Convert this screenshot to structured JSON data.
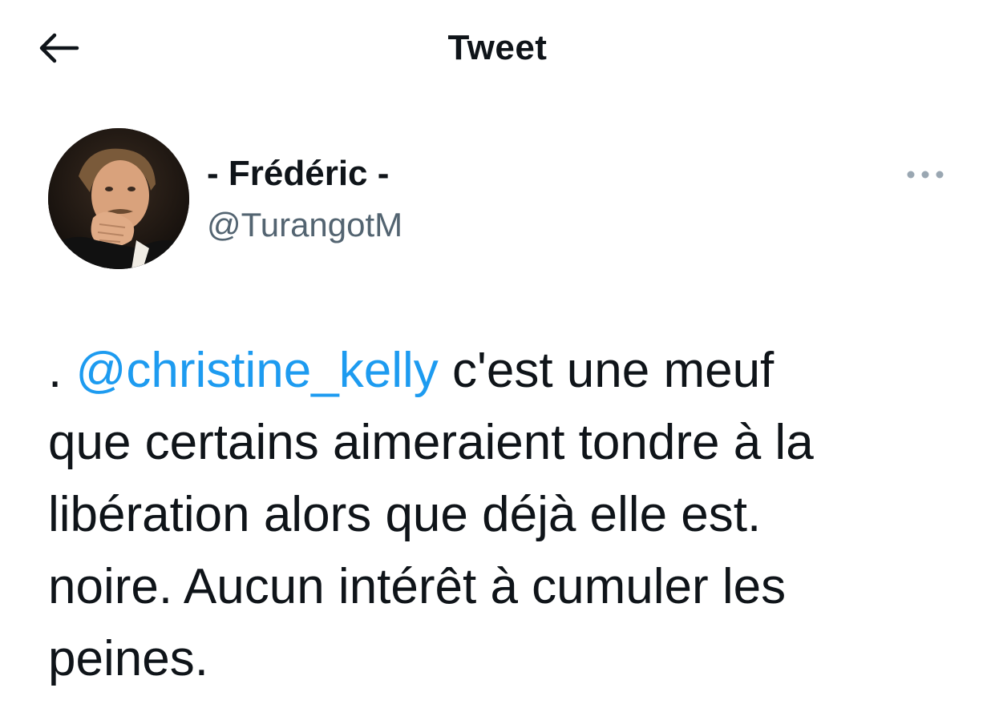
{
  "header": {
    "title": "Tweet",
    "back_icon": "arrow-left-icon"
  },
  "author": {
    "display_name": "- Frédéric -",
    "handle": "@TurangotM",
    "avatar": "profile-photo"
  },
  "more_icon": "ellipsis-icon",
  "tweet": {
    "prefix": ". ",
    "mention": "@christine_kelly",
    "body": " c'est une meuf\nque certains aimeraient tondre à la\nlibération alors que déjà elle est.\nnoire. Aucun intérêt à cumuler les\npeines."
  },
  "colors": {
    "mention_blue": "#1d9bf0",
    "secondary_text": "#536471",
    "primary_text": "#0f1419"
  }
}
